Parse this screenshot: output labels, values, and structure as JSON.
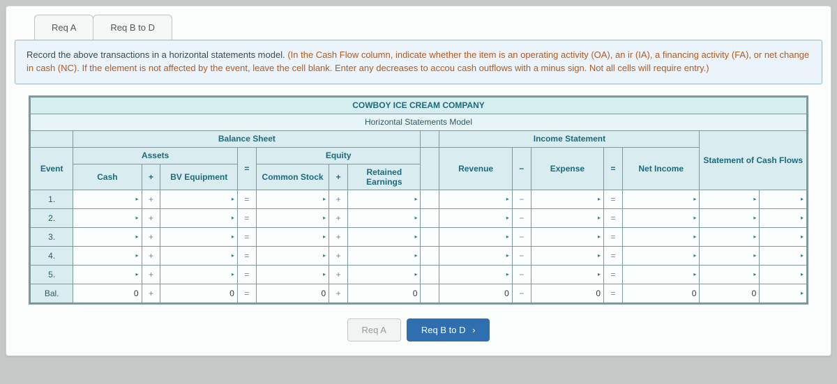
{
  "tabs": {
    "a": "Req A",
    "b": "Req B to D"
  },
  "instruction": {
    "lead": "Record the above transactions in a horizontal statements model. ",
    "paren": "(In the Cash Flow column, indicate whether the item is an operating activity (OA), an ir (IA), a financing activity (FA), or net change in cash (NC). If the element is not affected by the event, leave the cell blank. Enter any decreases to accou cash outflows with a minus sign. Not all cells will require entry.)"
  },
  "table": {
    "company": "COWBOY ICE CREAM COMPANY",
    "model": "Horizontal Statements Model",
    "balance_sheet": "Balance Sheet",
    "income_statement": "Income Statement",
    "event": "Event",
    "assets": "Assets",
    "equity": "Equity",
    "cash_flows": "Statement of Cash Flows",
    "cash": "Cash",
    "bv_equip": "BV Equipment",
    "common_stock": "Common Stock",
    "retained": "Retained Earnings",
    "revenue": "Revenue",
    "expense": "Expense",
    "net_income": "Net Income",
    "rows": [
      "1.",
      "2.",
      "3.",
      "4.",
      "5.",
      "Bal."
    ],
    "zero": "0",
    "plus": "+",
    "minus": "−",
    "equals": "="
  },
  "nav": {
    "prev": "Req A",
    "next": "Req B to D"
  },
  "chart_data": {
    "type": "table",
    "title": "Horizontal Statements Model",
    "company": "COWBOY ICE CREAM COMPANY",
    "columns": [
      "Event",
      "Cash",
      "BV Equipment",
      "Common Stock",
      "Retained Earnings",
      "Revenue",
      "Expense",
      "Net Income",
      "Cash Flows Amount",
      "Cash Flows Type"
    ],
    "rows": [
      {
        "event": "1.",
        "cash": null,
        "bv_equipment": null,
        "common_stock": null,
        "retained_earnings": null,
        "revenue": null,
        "expense": null,
        "net_income": null,
        "cf_amount": null,
        "cf_type": null
      },
      {
        "event": "2.",
        "cash": null,
        "bv_equipment": null,
        "common_stock": null,
        "retained_earnings": null,
        "revenue": null,
        "expense": null,
        "net_income": null,
        "cf_amount": null,
        "cf_type": null
      },
      {
        "event": "3.",
        "cash": null,
        "bv_equipment": null,
        "common_stock": null,
        "retained_earnings": null,
        "revenue": null,
        "expense": null,
        "net_income": null,
        "cf_amount": null,
        "cf_type": null
      },
      {
        "event": "4.",
        "cash": null,
        "bv_equipment": null,
        "common_stock": null,
        "retained_earnings": null,
        "revenue": null,
        "expense": null,
        "net_income": null,
        "cf_amount": null,
        "cf_type": null
      },
      {
        "event": "5.",
        "cash": null,
        "bv_equipment": null,
        "common_stock": null,
        "retained_earnings": null,
        "revenue": null,
        "expense": null,
        "net_income": null,
        "cf_amount": null,
        "cf_type": null
      },
      {
        "event": "Bal.",
        "cash": 0,
        "bv_equipment": 0,
        "common_stock": 0,
        "retained_earnings": 0,
        "revenue": 0,
        "expense": 0,
        "net_income": 0,
        "cf_amount": 0,
        "cf_type": null
      }
    ]
  }
}
